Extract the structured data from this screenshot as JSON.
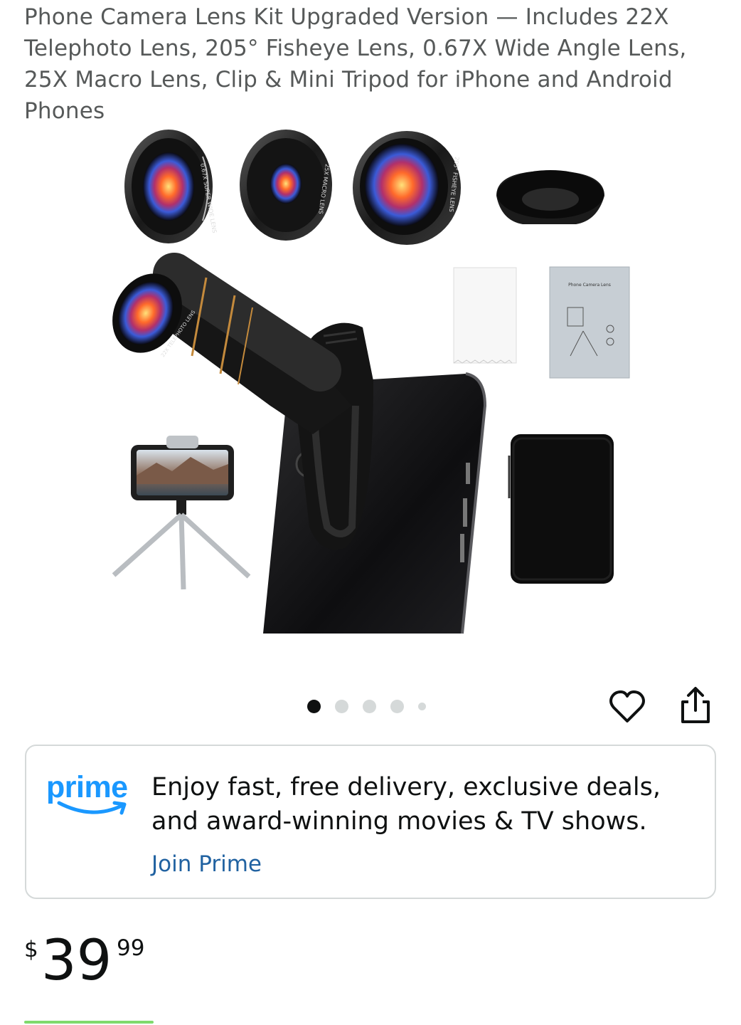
{
  "product": {
    "title": "Phone Camera Lens Kit Upgraded Version — Includes 22X Telephoto Lens, 205° Fisheye Lens, 0.67X Wide Angle Lens, 25X Macro Lens, Clip & Mini Tripod for iPhone and Android Phones",
    "image_labels": {
      "wide": "0.67X SUPER WIDE LENS",
      "macro": "25X MACRO LENS",
      "fisheye": "205° FISHEYE LENS",
      "telephoto": "22X TELEPHOTO LENS",
      "manual_title": "Phone Camera Lens"
    }
  },
  "carousel": {
    "count": 5,
    "active_index": 0
  },
  "icons": {
    "wishlist": "heart-icon",
    "share": "share-icon"
  },
  "prime": {
    "logo_word": "prime",
    "message": "Enjoy fast, free delivery, exclusive deals, and award-winning movies & TV shows.",
    "join_label": "Join Prime",
    "brand_color": "#1a98ff",
    "link_color": "#2162a1"
  },
  "price": {
    "currency": "$",
    "whole": "39",
    "fraction": "99"
  },
  "colors": {
    "progress": "#7fda6c"
  }
}
